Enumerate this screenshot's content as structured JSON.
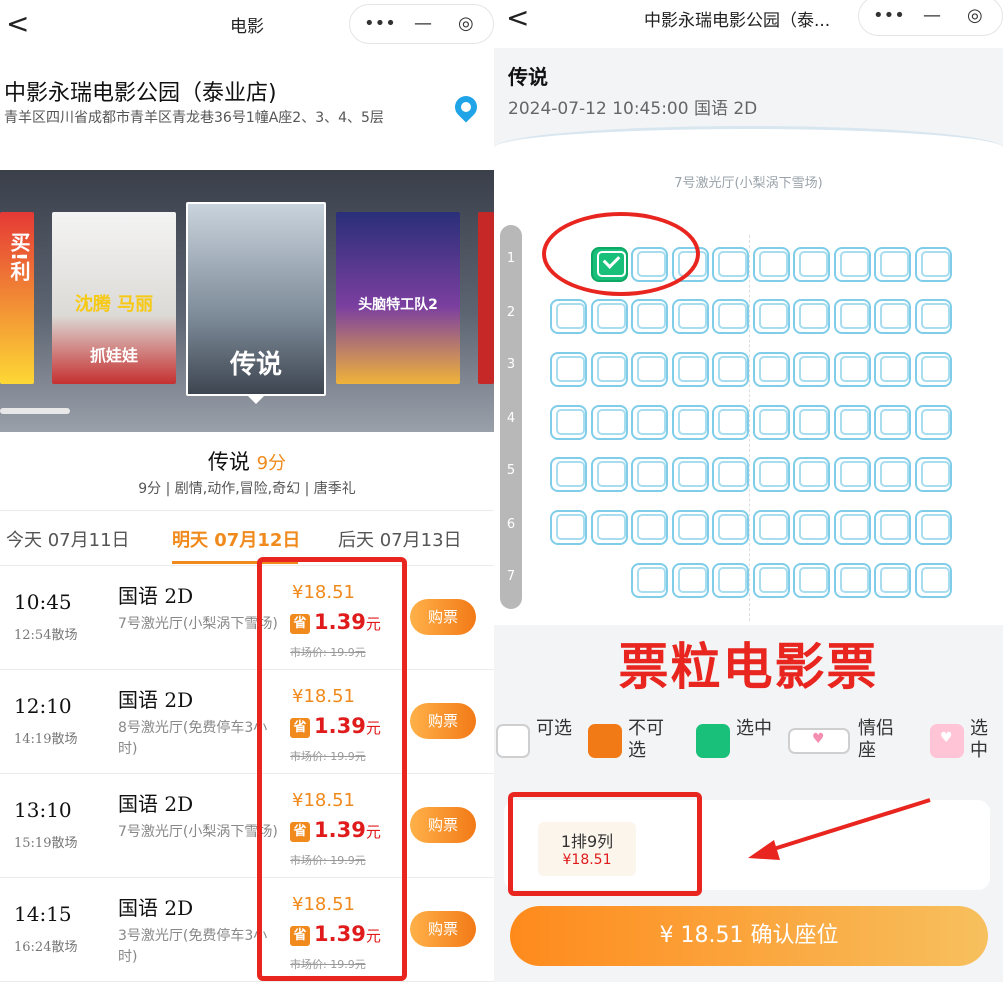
{
  "left": {
    "nav": {
      "back": "<",
      "title": "电影",
      "capsule": [
        "•••",
        "—",
        "◎"
      ]
    },
    "cinema": {
      "name": "中影永瑞电影公园（泰业店)",
      "address": "青羊区四川省成都市青羊区青龙巷36号1幢A座2、3、4、5层"
    },
    "posters": [
      {
        "text": "买!利"
      },
      {
        "text": "沈腾 马丽",
        "sub": "抓娃娃"
      },
      {
        "text": "传说"
      },
      {
        "text": "头脑特工队2"
      },
      {
        "text": ""
      }
    ],
    "movie": {
      "title": "传说",
      "score": "9分",
      "meta": "9分 | 剧情,动作,冒险,奇幻 | 唐季礼"
    },
    "dates": [
      "今天 07月11日",
      "明天 07月12日",
      "后天 07月13日"
    ],
    "showtimes": [
      {
        "time": "10:45",
        "end": "12:54散场",
        "lang": "国语 2D",
        "hall": "7号激光厅(小梨涡下雪场)",
        "price": "¥18.51",
        "save_tag": "省",
        "save": "1.39",
        "save_unit": "元",
        "market": "市场价: 19.9元",
        "buy": "购票"
      },
      {
        "time": "12:10",
        "end": "14:19散场",
        "lang": "国语 2D",
        "hall": "8号激光厅(免费停车3小时)",
        "price": "¥18.51",
        "save_tag": "省",
        "save": "1.39",
        "save_unit": "元",
        "market": "市场价: 19.9元",
        "buy": "购票"
      },
      {
        "time": "13:10",
        "end": "15:19散场",
        "lang": "国语 2D",
        "hall": "7号激光厅(小梨涡下雪场)",
        "price": "¥18.51",
        "save_tag": "省",
        "save": "1.39",
        "save_unit": "元",
        "market": "市场价: 19.9元",
        "buy": "购票"
      },
      {
        "time": "14:15",
        "end": "16:24散场",
        "lang": "国语 2D",
        "hall": "3号激光厅(免费停车3小时)",
        "price": "¥18.51",
        "save_tag": "省",
        "save": "1.39",
        "save_unit": "元",
        "market": "市场价: 19.9元",
        "buy": "购票"
      }
    ]
  },
  "right": {
    "nav": {
      "back": "<",
      "title": "中影永瑞电影公园（泰...",
      "capsule": [
        "•••",
        "—",
        "◎"
      ]
    },
    "movie_title": "传说",
    "session": "2024-07-12 10:45:00 国语 2D",
    "hall": "7号激光厅(小梨涡下雪场)",
    "rows": [
      "1",
      "2",
      "3",
      "4",
      "5",
      "6",
      "7"
    ],
    "selected_seat": {
      "row": 1,
      "col": 9
    },
    "watermark": "票粒电影票",
    "legend": [
      {
        "label": "可选",
        "color": "#ffffff"
      },
      {
        "label": "不可选",
        "color": "#f27a16"
      },
      {
        "label": "选中",
        "color": "#19c07a"
      },
      {
        "label": "情侣座",
        "color": "#ffffff"
      },
      {
        "label": "选中",
        "color": "#ffc4d6"
      }
    ],
    "chip": {
      "seat": "1排9列",
      "price": "¥18.51"
    },
    "confirm": "¥ 18.51 确认座位"
  }
}
